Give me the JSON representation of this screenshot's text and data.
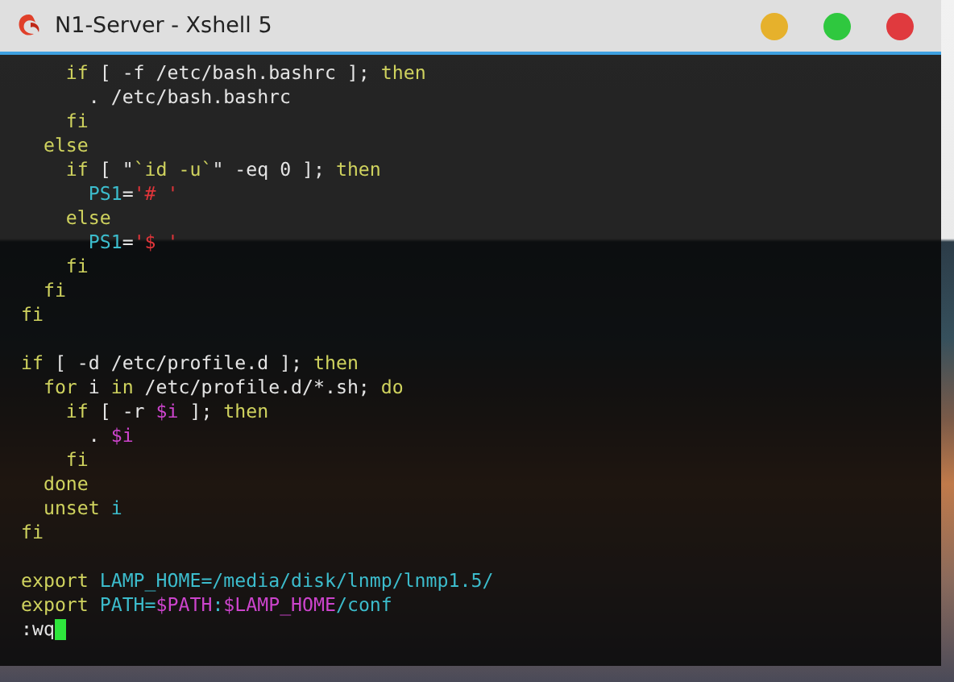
{
  "window": {
    "title": "N1-Server - Xshell 5"
  },
  "window_buttons": [
    {
      "color": "#e6b12c"
    },
    {
      "color": "#2fc83f"
    },
    {
      "color": "#e03a3e"
    }
  ],
  "terminal": {
    "lines": [
      {
        "kind": "code",
        "segments": [
          {
            "kind": "kw",
            "text": "    if"
          },
          {
            "kind": "plain",
            "text": " [ -f /etc/bash.bashrc ]; "
          },
          {
            "kind": "kw",
            "text": "then"
          }
        ]
      },
      {
        "kind": "code",
        "segments": [
          {
            "kind": "plain",
            "text": "      . /etc/bash.bashrc"
          }
        ]
      },
      {
        "kind": "code",
        "segments": [
          {
            "kind": "kw",
            "text": "    fi"
          }
        ]
      },
      {
        "kind": "code",
        "segments": [
          {
            "kind": "kw",
            "text": "  else"
          }
        ]
      },
      {
        "kind": "code",
        "segments": [
          {
            "kind": "kw",
            "text": "    if"
          },
          {
            "kind": "plain",
            "text": " [ \""
          },
          {
            "kind": "kw",
            "text": "`id -u`"
          },
          {
            "kind": "plain",
            "text": "\" -eq 0 ]; "
          },
          {
            "kind": "kw",
            "text": "then"
          }
        ]
      },
      {
        "kind": "code",
        "segments": [
          {
            "kind": "name",
            "text": "      PS1"
          },
          {
            "kind": "plain",
            "text": "="
          },
          {
            "kind": "str",
            "text": "'# '"
          }
        ]
      },
      {
        "kind": "code",
        "segments": [
          {
            "kind": "kw",
            "text": "    else"
          }
        ]
      },
      {
        "kind": "code",
        "segments": [
          {
            "kind": "name",
            "text": "      PS1"
          },
          {
            "kind": "plain",
            "text": "="
          },
          {
            "kind": "str",
            "text": "'$ '"
          }
        ]
      },
      {
        "kind": "code",
        "segments": [
          {
            "kind": "kw",
            "text": "    fi"
          }
        ]
      },
      {
        "kind": "code",
        "segments": [
          {
            "kind": "kw",
            "text": "  fi"
          }
        ]
      },
      {
        "kind": "code",
        "segments": [
          {
            "kind": "kw",
            "text": "fi"
          }
        ]
      },
      {
        "kind": "blank"
      },
      {
        "kind": "code",
        "segments": [
          {
            "kind": "kw",
            "text": "if"
          },
          {
            "kind": "plain",
            "text": " [ -d /etc/profile.d ]; "
          },
          {
            "kind": "kw",
            "text": "then"
          }
        ]
      },
      {
        "kind": "code",
        "segments": [
          {
            "kind": "kw",
            "text": "  for"
          },
          {
            "kind": "plain",
            "text": " i "
          },
          {
            "kind": "kw",
            "text": "in"
          },
          {
            "kind": "plain",
            "text": " /etc/profile.d/*.sh; "
          },
          {
            "kind": "kw",
            "text": "do"
          }
        ]
      },
      {
        "kind": "code",
        "segments": [
          {
            "kind": "kw",
            "text": "    if"
          },
          {
            "kind": "plain",
            "text": " [ -r "
          },
          {
            "kind": "var",
            "text": "$i"
          },
          {
            "kind": "plain",
            "text": " ]; "
          },
          {
            "kind": "kw",
            "text": "then"
          }
        ]
      },
      {
        "kind": "code",
        "segments": [
          {
            "kind": "plain",
            "text": "      . "
          },
          {
            "kind": "var",
            "text": "$i"
          }
        ]
      },
      {
        "kind": "code",
        "segments": [
          {
            "kind": "kw",
            "text": "    fi"
          }
        ]
      },
      {
        "kind": "code",
        "segments": [
          {
            "kind": "kw",
            "text": "  done"
          }
        ]
      },
      {
        "kind": "code",
        "segments": [
          {
            "kind": "kw",
            "text": "  unset"
          },
          {
            "kind": "name",
            "text": " i"
          }
        ]
      },
      {
        "kind": "code",
        "segments": [
          {
            "kind": "kw",
            "text": "fi"
          }
        ]
      },
      {
        "kind": "blank"
      },
      {
        "kind": "code",
        "segments": [
          {
            "kind": "kw",
            "text": "export"
          },
          {
            "kind": "name",
            "text": " LAMP_HOME=/media/disk/lnmp/lnmp1.5/"
          }
        ]
      },
      {
        "kind": "code",
        "segments": [
          {
            "kind": "kw",
            "text": "export"
          },
          {
            "kind": "name",
            "text": " PATH="
          },
          {
            "kind": "var",
            "text": "$PATH"
          },
          {
            "kind": "name",
            "text": ":"
          },
          {
            "kind": "var",
            "text": "$LAMP_HOME"
          },
          {
            "kind": "name",
            "text": "/conf"
          }
        ]
      },
      {
        "kind": "prompt",
        "segments": [
          {
            "kind": "plain",
            "text": ":wq"
          }
        ]
      }
    ]
  }
}
